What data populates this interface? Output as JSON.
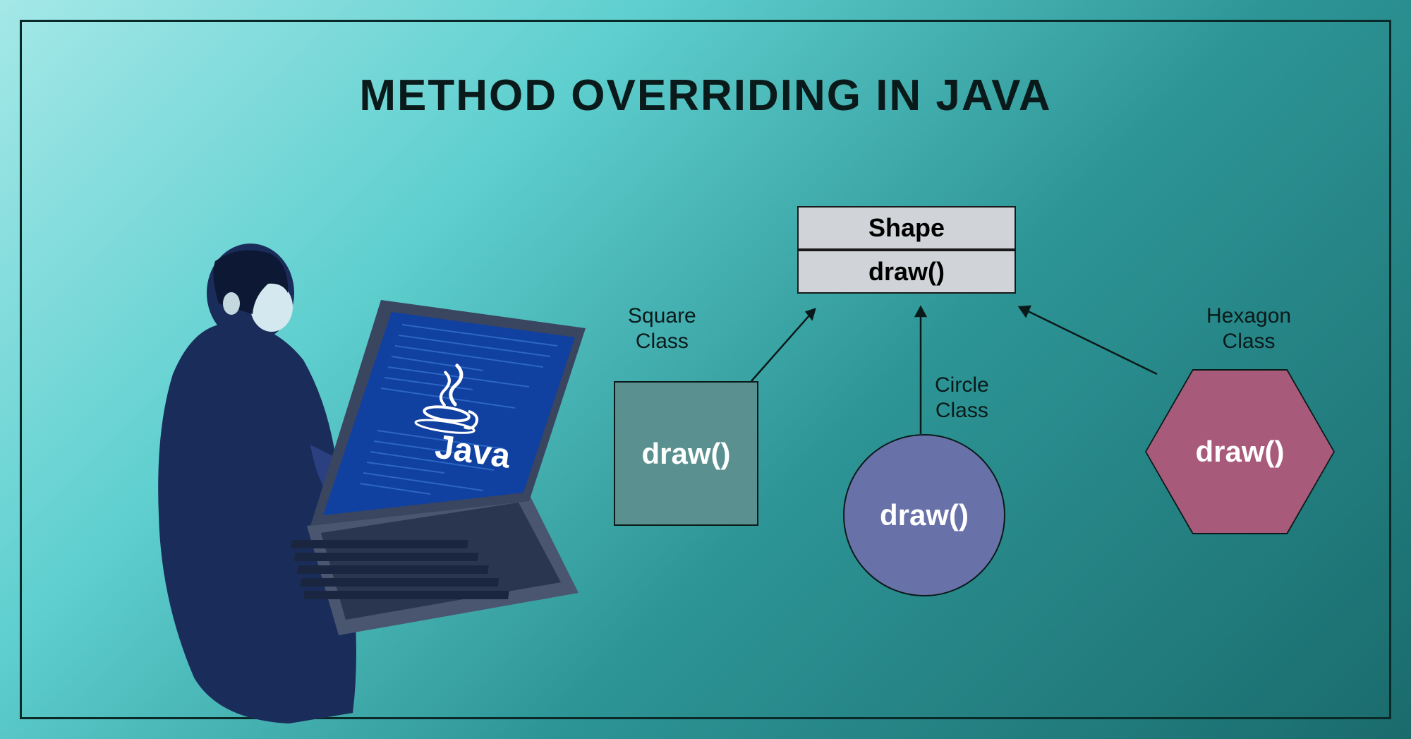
{
  "title": "METHOD OVERRIDING IN JAVA",
  "laptop_text": "Java",
  "parent": {
    "class_name": "Shape",
    "method": "draw()"
  },
  "children": {
    "square": {
      "label_line1": "Square",
      "label_line2": "Class",
      "method": "draw()"
    },
    "circle": {
      "label_line1": "Circle",
      "label_line2": "Class",
      "method": "draw()"
    },
    "hexagon": {
      "label_line1": "Hexagon",
      "label_line2": "Class",
      "method": "draw()"
    }
  }
}
